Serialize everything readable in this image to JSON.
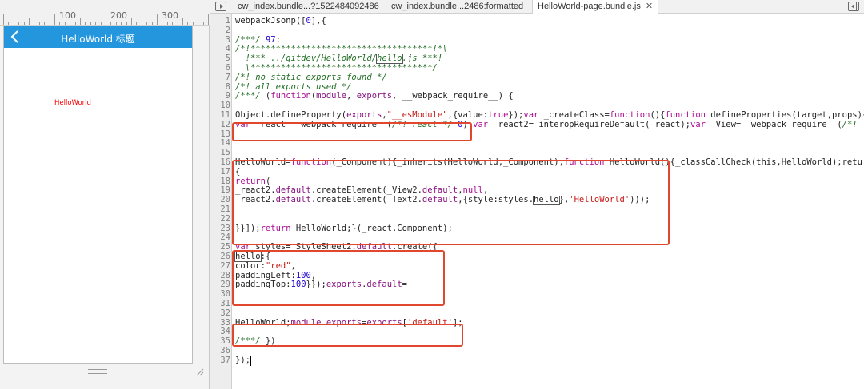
{
  "ruler": {
    "marks": [
      "100",
      "200",
      "300"
    ]
  },
  "device": {
    "nav_title": "HelloWorld 标题",
    "hello_text": "HelloWorld",
    "navbar_color": "#2496de",
    "text_color": "#ff0000"
  },
  "tabs": [
    {
      "label": "cw_index.bundle...?1522484092486",
      "active": false
    },
    {
      "label": "cw_index.bundle...2486:formatted",
      "active": false
    },
    {
      "label": "HelloWorld-page.bundle.js",
      "active": true
    }
  ],
  "icons": {
    "nav_toggle": "show-navigator-icon",
    "debug_toggle": "show-debugger-icon",
    "back": "back-arrow-icon",
    "close": "close-icon"
  },
  "code_lines": [
    "webpackJsonp([0],{",
    "",
    "/***/ 97:",
    "/*!************************************!*\\",
    "  !*** ../gitdev/HelloWorld/hello.js ***!",
    "  \\************************************/",
    "/*! no static exports found */",
    "/*! all exports used */",
    "/***/ (function(module, exports, __webpack_require__) {",
    "",
    "Object.defineProperty(exports,\"__esModule\",{value:true});var _createClass=function(){function defineProperties(target,props){",
    "var _react=__webpack_require__(/*! react */ 0);var _react2=_interopRequireDefault(_react);var _View=__webpack_require__(/*!",
    "",
    "",
    "",
    "HelloWorld=function(_Component){_inherits(HelloWorld,_Component);function HelloWorld(){_classCallCheck(this,HelloWorld);retu",
    "{",
    "return(",
    "_react2.default.createElement(_View2.default,null,",
    "_react2.default.createElement(_Text2.default,{style:styles.hello},'HelloWorld')));",
    "",
    "",
    "}}]);return HelloWorld;}(_react.Component);",
    "",
    "var styles=_StyleSheet2.default.create({",
    "hello:{",
    "color:\"red\",",
    "paddingLeft:100,",
    "paddingTop:100}});exports.default=",
    "",
    "",
    "",
    "HelloWorld;module.exports=exports['default'];",
    "",
    "/***/ })",
    "",
    "});"
  ],
  "highlight_color": "#e0472e"
}
